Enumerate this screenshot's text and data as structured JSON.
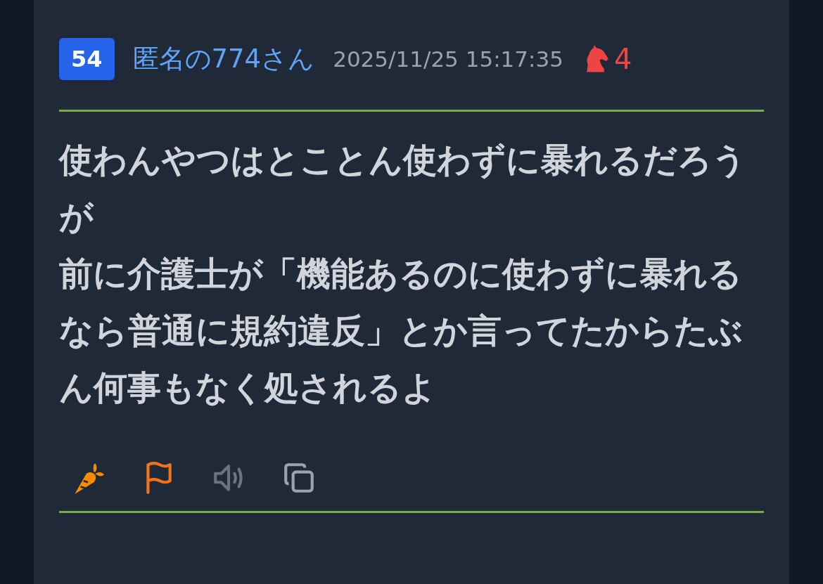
{
  "post": {
    "number": "54",
    "author": "匿名の774さん",
    "timestamp": "2025/11/25 15:17:35",
    "reaction_count": "4",
    "body": [
      "使わんやつはとことん使わずに暴れるだろうが",
      "前に介護士が「機能あるのに使わずに暴れるなら普通に規約違反」とか言ってたからたぶん何事もなく処されるよ"
    ],
    "actions": [
      {
        "kind": "carrot"
      },
      {
        "kind": "flag"
      },
      {
        "kind": "speaker"
      },
      {
        "kind": "copy"
      }
    ]
  }
}
